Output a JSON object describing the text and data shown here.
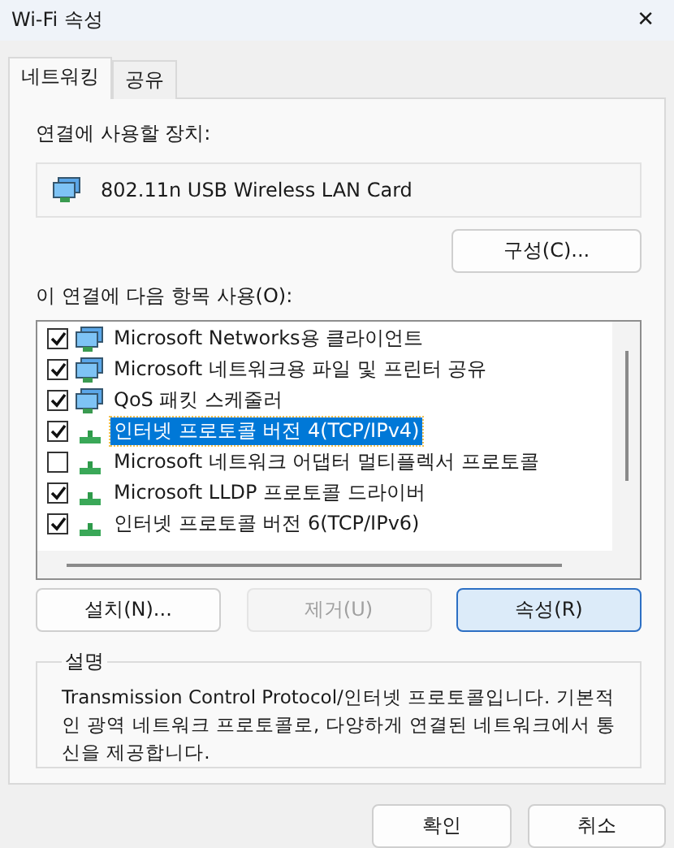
{
  "window": {
    "title": "Wi-Fi 속성",
    "close": "✕"
  },
  "tabs": [
    {
      "label": "네트워킹",
      "selected": true
    },
    {
      "label": "공유",
      "selected": false
    }
  ],
  "device": {
    "label": "연결에 사용할 장치:",
    "name": "802.11n USB Wireless LAN Card",
    "configure": "구성(C)..."
  },
  "components": {
    "label": "이 연결에 다음 항목 사용(O):",
    "items": [
      {
        "kind": "client",
        "name": "Microsoft Networks용 클라이언트",
        "checked": true,
        "selected": false
      },
      {
        "kind": "service",
        "name": "Microsoft 네트워크용 파일 및 프린터 공유",
        "checked": true,
        "selected": false
      },
      {
        "kind": "service",
        "name": "QoS 패킷 스케줄러",
        "checked": true,
        "selected": false
      },
      {
        "kind": "protocol",
        "name": "인터넷 프로토콜 버전 4(TCP/IPv4)",
        "checked": true,
        "selected": true
      },
      {
        "kind": "protocol",
        "name": "Microsoft 네트워크 어댑터 멀티플렉서 프로토콜",
        "checked": false,
        "selected": false
      },
      {
        "kind": "protocol",
        "name": "Microsoft LLDP 프로토콜 드라이버",
        "checked": true,
        "selected": false
      },
      {
        "kind": "protocol",
        "name": "인터넷 프로토콜 버전 6(TCP/IPv6)",
        "checked": true,
        "selected": false
      }
    ]
  },
  "actions": [
    {
      "label": "설치(N)...",
      "disabled": false,
      "default": false
    },
    {
      "label": "제거(U)",
      "disabled": true,
      "default": false
    },
    {
      "label": "속성(R)",
      "disabled": false,
      "default": true
    }
  ],
  "description": {
    "title": "설명",
    "text": "Transmission Control Protocol/인터넷 프로토콜입니다. 기본적인 광역 네트워크 프로토콜로, 다양하게 연결된 네트워크에서 통신을 제공합니다."
  },
  "buttons": [
    "확인",
    "취소"
  ]
}
